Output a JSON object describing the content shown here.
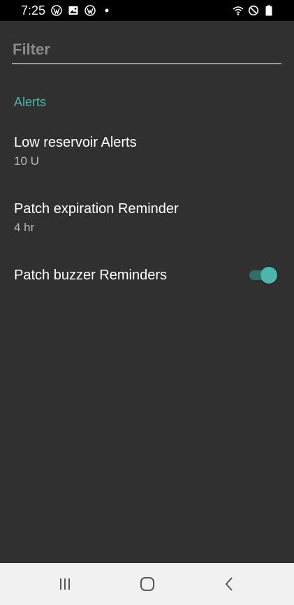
{
  "status_bar": {
    "time": "7:25",
    "left_icons": [
      "wordpress-icon",
      "image-icon",
      "wordpress-icon",
      "dot-icon"
    ],
    "right_icons": [
      "wifi-icon",
      "do-not-disturb-icon",
      "battery-icon"
    ]
  },
  "filter": {
    "placeholder": "Filter",
    "value": ""
  },
  "category": {
    "title": "Alerts"
  },
  "preferences": [
    {
      "title": "Low reservoir Alerts",
      "summary": "10 U"
    },
    {
      "title": "Patch expiration Reminder",
      "summary": "4 hr"
    },
    {
      "title": "Patch buzzer Reminders",
      "toggle": true
    }
  ],
  "nav_bar": {
    "buttons": [
      "recents-icon",
      "home-icon",
      "back-icon"
    ]
  },
  "colors": {
    "accent": "#4db6ac",
    "background": "#303030",
    "status_bar": "#000000",
    "nav_bar": "#f1f1f1"
  }
}
